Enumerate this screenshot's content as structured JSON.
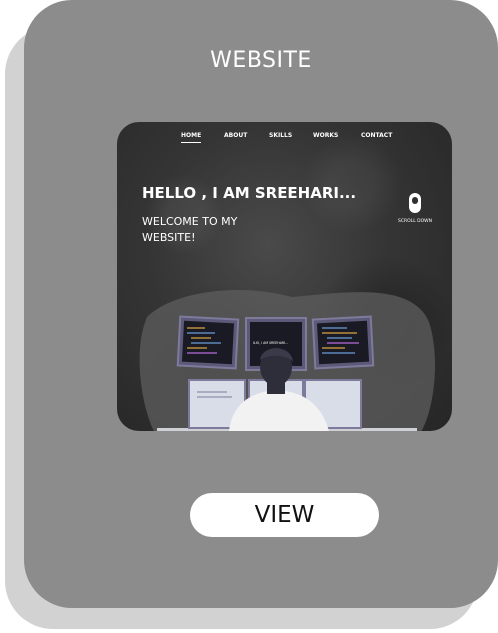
{
  "card": {
    "title": "WEBSITE",
    "button_label": "VIEW"
  },
  "preview": {
    "nav": [
      "HOME",
      "ABOUT",
      "SKILLS",
      "WORKS",
      "CONTACT"
    ],
    "active_nav": "HOME",
    "hero_title": "HELLO , I AM SREEHARI...",
    "hero_subtitle": "WELCOME TO MY WEBSITE!",
    "scroll_label": "SCROLL DOWN",
    "monitor_text": "ILIO, I AM SREEHARI..."
  },
  "colors": {
    "card_bg": "#8c8c8c",
    "shadow_bg": "#d2d2d2",
    "preview_bg": "#353535",
    "button_bg": "#ffffff"
  }
}
